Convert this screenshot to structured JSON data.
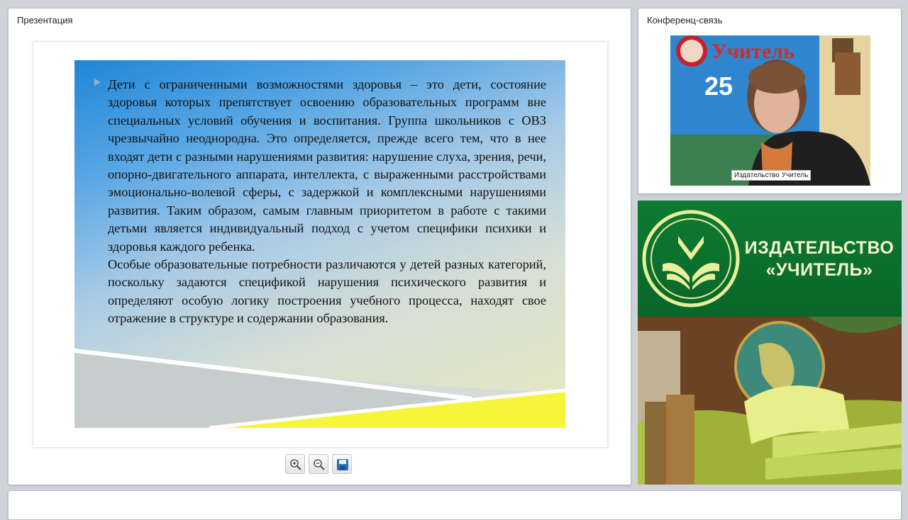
{
  "presentation": {
    "title": "Презентация",
    "slide": {
      "paragraph1": "Дети с ограниченными возможностями здоровья – это дети, состояние здоровья которых препятствует освоению образовательных программ вне специальных условий обучения и воспитания. Группа школьников с ОВЗ чрезвычайно неоднородна. Это определяется, прежде всего тем, что в нее входят дети с разными нарушениями развития: нарушение слуха, зрения, речи, опорно-двигательного аппарата, интеллекта, с выраженными расстройствами эмоционально-волевой сферы, с задержкой и комплексными нарушениями развития. Таким образом, самым главным приоритетом в работе с такими детьми является индивидуальный подход с учетом специфики психики и здоровья каждого ребенка.",
      "paragraph2": "Особые образовательные потребности различаются у детей разных категорий, поскольку задаются спецификой нарушения психического развития и определяют особую логику построения учебного процесса, находят свое отражение в структуре и содержании образования."
    },
    "toolbar": {
      "zoom_in": "zoom-in-icon",
      "zoom_out": "zoom-out-icon",
      "save": "save-icon"
    }
  },
  "conference": {
    "title": "Конференц-связь",
    "participant_label": "Издательство Учитель",
    "video_backdrop_text": "Учитель",
    "video_backdrop_years": "25"
  },
  "publisher": {
    "line1": "ИЗДАТЕЛЬСТВО",
    "line2": "«УЧИТЕЛЬ»"
  },
  "colors": {
    "banner_green": "#0b6b2b",
    "banner_text": "#f2f5c9",
    "slide_blue": "#1f86d8"
  }
}
